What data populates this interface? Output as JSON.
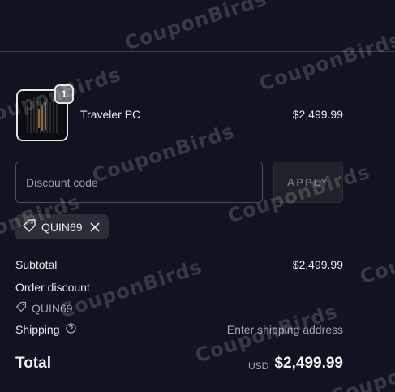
{
  "product": {
    "quantity": "1",
    "name": "Traveler PC",
    "price": "$2,499.99"
  },
  "discount": {
    "placeholder": "Discount code",
    "apply_label": "APPLY",
    "applied_code": "QUIN69"
  },
  "summary": {
    "subtotal_label": "Subtotal",
    "subtotal_value": "$2,499.99",
    "order_discount_label": "Order discount",
    "order_discount_code": "QUIN69",
    "shipping_label": "Shipping",
    "shipping_value": "Enter shipping address",
    "total_label": "Total",
    "total_currency": "USD",
    "total_value": "$2,499.99"
  },
  "watermark": "CouponBirds",
  "icons": {
    "tag": "tag-icon",
    "remove": "close-icon",
    "help": "help-circle-icon"
  },
  "colors": {
    "background": "#0f1420",
    "apply_button_bg": "#1f2329",
    "tag_bg": "#2a2e36"
  }
}
